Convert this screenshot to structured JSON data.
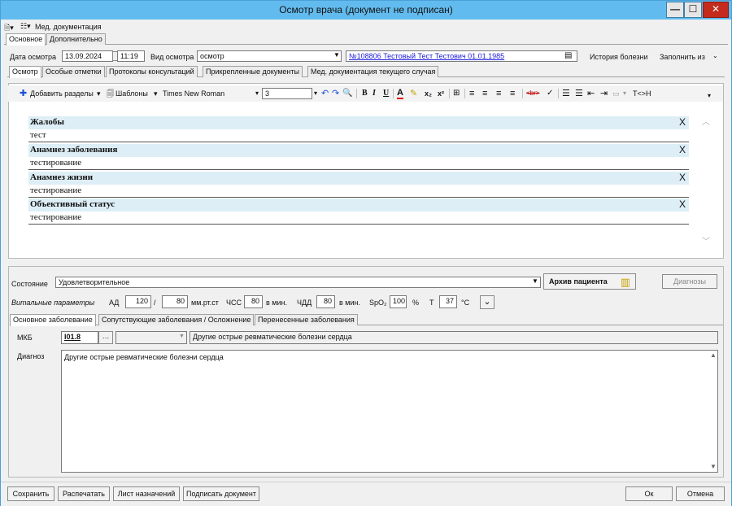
{
  "window": {
    "title": "Осмотр врача (документ не подписан)",
    "min_glyph": "—",
    "max_glyph": "☐",
    "close_glyph": "✕"
  },
  "top_toolbar": {
    "med_docs_label": "Мед. документация"
  },
  "main_tabs": [
    "Основное",
    "Дополнительно"
  ],
  "header": {
    "date_label": "Дата осмотра",
    "date_value": "13.09.2024",
    "time_value": "11:19",
    "type_label": "Вид осмотра",
    "type_value": "осмотр",
    "patient_link": "№108806 Тестовый Тест Тестович 01.01.1985",
    "history_label": "История болезни",
    "fill_from_label": "Заполнить из"
  },
  "sub_tabs": [
    "Осмотр",
    "Особые отметки",
    "Протоколы консультаций",
    "Прикрепленные документы",
    "Мед. документация текущего случая"
  ],
  "editor_toolbar": {
    "add_sections": "Добавить разделы",
    "templates": "Шаблоны",
    "font_name": "Times New Roman",
    "font_size": "3",
    "br_tag": "<br>",
    "t_h": "T<>H"
  },
  "sections": [
    {
      "title": "Жалобы",
      "body": "тест",
      "close": "X"
    },
    {
      "title": "Анамнез заболевания",
      "body": "тестирование",
      "close": "X"
    },
    {
      "title": "Анамнез жизни",
      "body": "тестирование",
      "close": "X"
    },
    {
      "title": "Объективный статус",
      "body": "тестирование",
      "close": "X"
    }
  ],
  "status": {
    "label": "Состояние",
    "value": "Удовлетворительное",
    "archive_button": "Архив пациента",
    "diagnoses_button": "Диагнозы"
  },
  "vitals": {
    "label": "Витальные параметры",
    "ad_label": "АД",
    "ad_sys": "120",
    "ad_sep": "/",
    "ad_dia": "80",
    "ad_unit": "мм.рт.ст",
    "hr_label": "ЧСС",
    "hr_value": "80",
    "hr_unit": "в мин.",
    "rr_label": "ЧДД",
    "rr_value": "80",
    "rr_unit": "в мин.",
    "spo2_label": "SpO₂",
    "spo2_value": "100",
    "spo2_unit": "%",
    "t_label": "T",
    "t_value": "37",
    "t_unit": "°C"
  },
  "diag_tabs": [
    "Основное заболевание",
    "Сопутствующие заболевания / Осложнение",
    "Перенесенные заболевания"
  ],
  "diagnosis": {
    "mkb_label": "МКБ",
    "mkb_code": "I01.8",
    "mkb_name": "Другие острые ревматические болезни сердца",
    "diag_label": "Диагноз",
    "diag_text": "Другие острые ревматические болезни сердца"
  },
  "bottom_buttons": {
    "save": "Сохранить",
    "print": "Распечатать",
    "prescriptions": "Лист назначений",
    "sign": "Подписать документ",
    "ok": "Ок",
    "cancel": "Отмена"
  }
}
